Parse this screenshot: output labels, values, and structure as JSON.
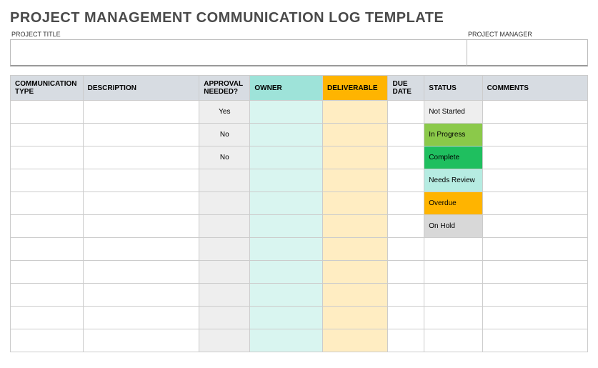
{
  "title": "PROJECT MANAGEMENT COMMUNICATION LOG TEMPLATE",
  "fields": {
    "project_title_label": "PROJECT TITLE",
    "project_title_value": "",
    "project_manager_label": "PROJECT MANAGER",
    "project_manager_value": ""
  },
  "table": {
    "headers": {
      "type": "COMMUNICATION TYPE",
      "description": "DESCRIPTION",
      "approval": "APPROVAL NEEDED?",
      "owner": "OWNER",
      "deliverable": "DELIVERABLE",
      "due": "DUE DATE",
      "status": "STATUS",
      "comments": "COMMENTS"
    },
    "rows": [
      {
        "type": "",
        "description": "",
        "approval": "Yes",
        "owner": "",
        "deliverable": "",
        "due": "",
        "status": "Not Started",
        "status_class": "st-notstarted",
        "comments": ""
      },
      {
        "type": "",
        "description": "",
        "approval": "No",
        "owner": "",
        "deliverable": "",
        "due": "",
        "status": "In Progress",
        "status_class": "st-inprogress",
        "comments": ""
      },
      {
        "type": "",
        "description": "",
        "approval": "No",
        "owner": "",
        "deliverable": "",
        "due": "",
        "status": "Complete",
        "status_class": "st-complete",
        "comments": ""
      },
      {
        "type": "",
        "description": "",
        "approval": "",
        "owner": "",
        "deliverable": "",
        "due": "",
        "status": "Needs Review",
        "status_class": "st-needsreview",
        "comments": ""
      },
      {
        "type": "",
        "description": "",
        "approval": "",
        "owner": "",
        "deliverable": "",
        "due": "",
        "status": "Overdue",
        "status_class": "st-overdue",
        "comments": ""
      },
      {
        "type": "",
        "description": "",
        "approval": "",
        "owner": "",
        "deliverable": "",
        "due": "",
        "status": "On Hold",
        "status_class": "st-onhold",
        "comments": ""
      },
      {
        "type": "",
        "description": "",
        "approval": "",
        "owner": "",
        "deliverable": "",
        "due": "",
        "status": "",
        "status_class": "",
        "comments": ""
      },
      {
        "type": "",
        "description": "",
        "approval": "",
        "owner": "",
        "deliverable": "",
        "due": "",
        "status": "",
        "status_class": "",
        "comments": ""
      },
      {
        "type": "",
        "description": "",
        "approval": "",
        "owner": "",
        "deliverable": "",
        "due": "",
        "status": "",
        "status_class": "",
        "comments": ""
      },
      {
        "type": "",
        "description": "",
        "approval": "",
        "owner": "",
        "deliverable": "",
        "due": "",
        "status": "",
        "status_class": "",
        "comments": ""
      },
      {
        "type": "",
        "description": "",
        "approval": "",
        "owner": "",
        "deliverable": "",
        "due": "",
        "status": "",
        "status_class": "",
        "comments": ""
      }
    ]
  }
}
